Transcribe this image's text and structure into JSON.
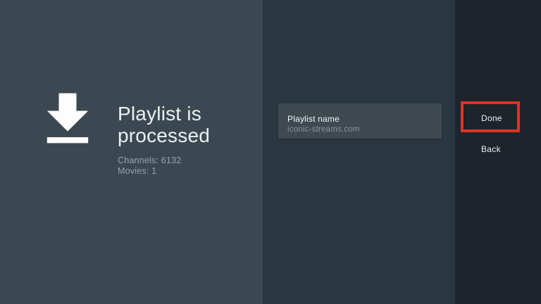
{
  "colors": {
    "left_panel_bg": "#3b4851",
    "middle_panel_bg": "#2b3740",
    "right_panel_bg": "#1e242b",
    "card_bg": "#3e4950",
    "highlight_red": "#dc3424",
    "text_primary": "#edf0f1",
    "text_muted": "#99a4ab"
  },
  "status": {
    "icon": "download-icon",
    "title": "Playlist is processed",
    "channels": "Channels: 6132",
    "movies": "Movies: 1"
  },
  "playlist_card": {
    "label": "Playlist name",
    "value": "iconic-streams.com"
  },
  "actions": {
    "done": "Done",
    "back": "Back"
  }
}
